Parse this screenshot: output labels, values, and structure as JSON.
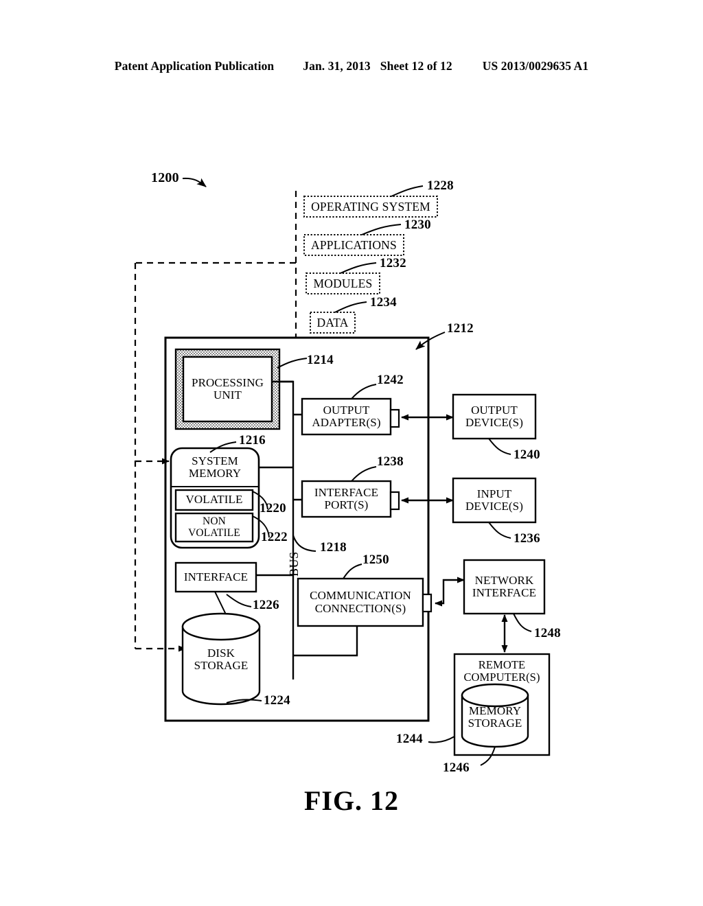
{
  "header": {
    "publication": "Patent Application Publication",
    "date": "Jan. 31, 2013",
    "sheet": "Sheet 12 of 12",
    "number": "US 2013/0029635 A1"
  },
  "figure": {
    "caption": "FIG. 12",
    "system_ref": "1200"
  },
  "software_stack": [
    {
      "label": "OPERATING SYSTEM",
      "ref": "1228"
    },
    {
      "label": "APPLICATIONS",
      "ref": "1230"
    },
    {
      "label": "MODULES",
      "ref": "1232"
    },
    {
      "label": "DATA",
      "ref": "1234"
    }
  ],
  "computer": {
    "ref": "1212",
    "bus_label": "BUS",
    "bus_ref": "1218",
    "blocks": [
      {
        "name": "processing-unit",
        "label": "PROCESSING\nUNIT",
        "ref": "1214"
      },
      {
        "name": "system-memory",
        "label": "SYSTEM\nMEMORY",
        "ref": "1216"
      },
      {
        "name": "volatile-memory",
        "label": "VOLATILE",
        "ref": "1220"
      },
      {
        "name": "non-volatile-memory",
        "label": "NON\nVOLATILE",
        "ref": "1222"
      },
      {
        "name": "interface",
        "label": "INTERFACE",
        "ref": "1226"
      },
      {
        "name": "disk-storage",
        "label": "DISK\nSTORAGE",
        "ref": "1224"
      },
      {
        "name": "output-adapters",
        "label": "OUTPUT\nADAPTER(S)",
        "ref": "1242"
      },
      {
        "name": "interface-ports",
        "label": "INTERFACE\nPORT(S)",
        "ref": "1238"
      },
      {
        "name": "communication-connections",
        "label": "COMMUNICATION\nCONNECTION(S)",
        "ref": "1250"
      }
    ]
  },
  "external": [
    {
      "name": "output-devices",
      "label": "OUTPUT\nDEVICE(S)",
      "ref": "1240"
    },
    {
      "name": "input-devices",
      "label": "INPUT\nDEVICE(S)",
      "ref": "1236"
    },
    {
      "name": "network-interface",
      "label": "NETWORK\nINTERFACE",
      "ref": "1248"
    },
    {
      "name": "remote-computers",
      "label": "REMOTE\nCOMPUTER(S)",
      "ref": "1244"
    },
    {
      "name": "memory-storage",
      "label": "MEMORY\nSTORAGE",
      "ref": "1246"
    }
  ],
  "colors": {
    "ink": "#000000",
    "paper": "#ffffff",
    "hatch": "#9a9a9a"
  }
}
